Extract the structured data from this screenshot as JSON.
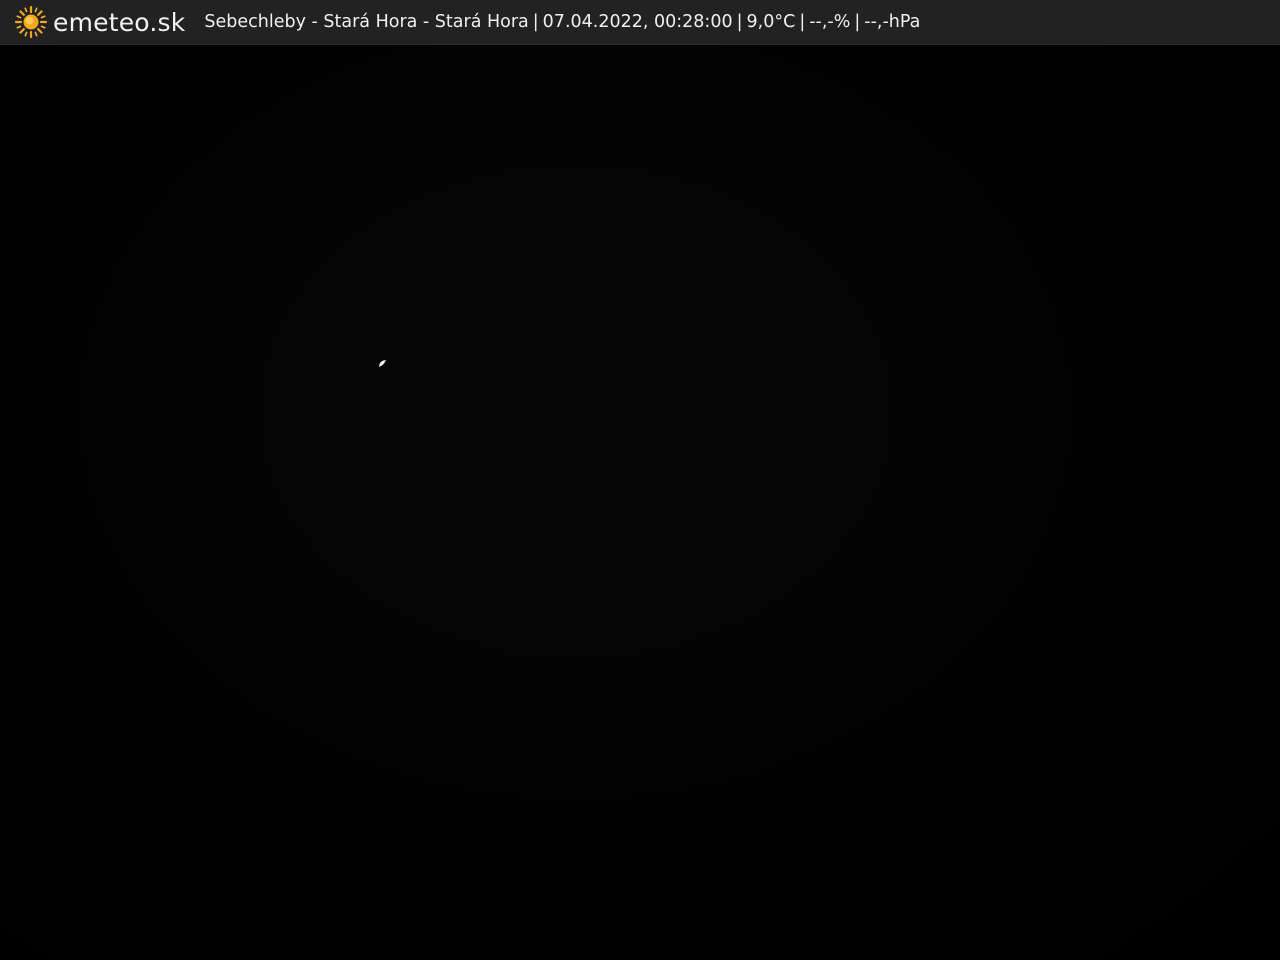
{
  "site": {
    "logo_text": "emeteo.sk",
    "logo_icon": "sun-icon",
    "logo_color": "#f5a623"
  },
  "station": {
    "name": "Sebechleby - Stará Hora - Stará Hora",
    "datetime": "07.04.2022, 00:28:00",
    "temperature": "9,0°C",
    "humidity": "--,-%",
    "pressure": "--,-hPa"
  },
  "webcam": {
    "scene": "night-sky",
    "object_icon": "moon-icon"
  },
  "colors": {
    "header_bg": "#222222",
    "text": "#f0f0f0",
    "view_bg": "#020202"
  }
}
